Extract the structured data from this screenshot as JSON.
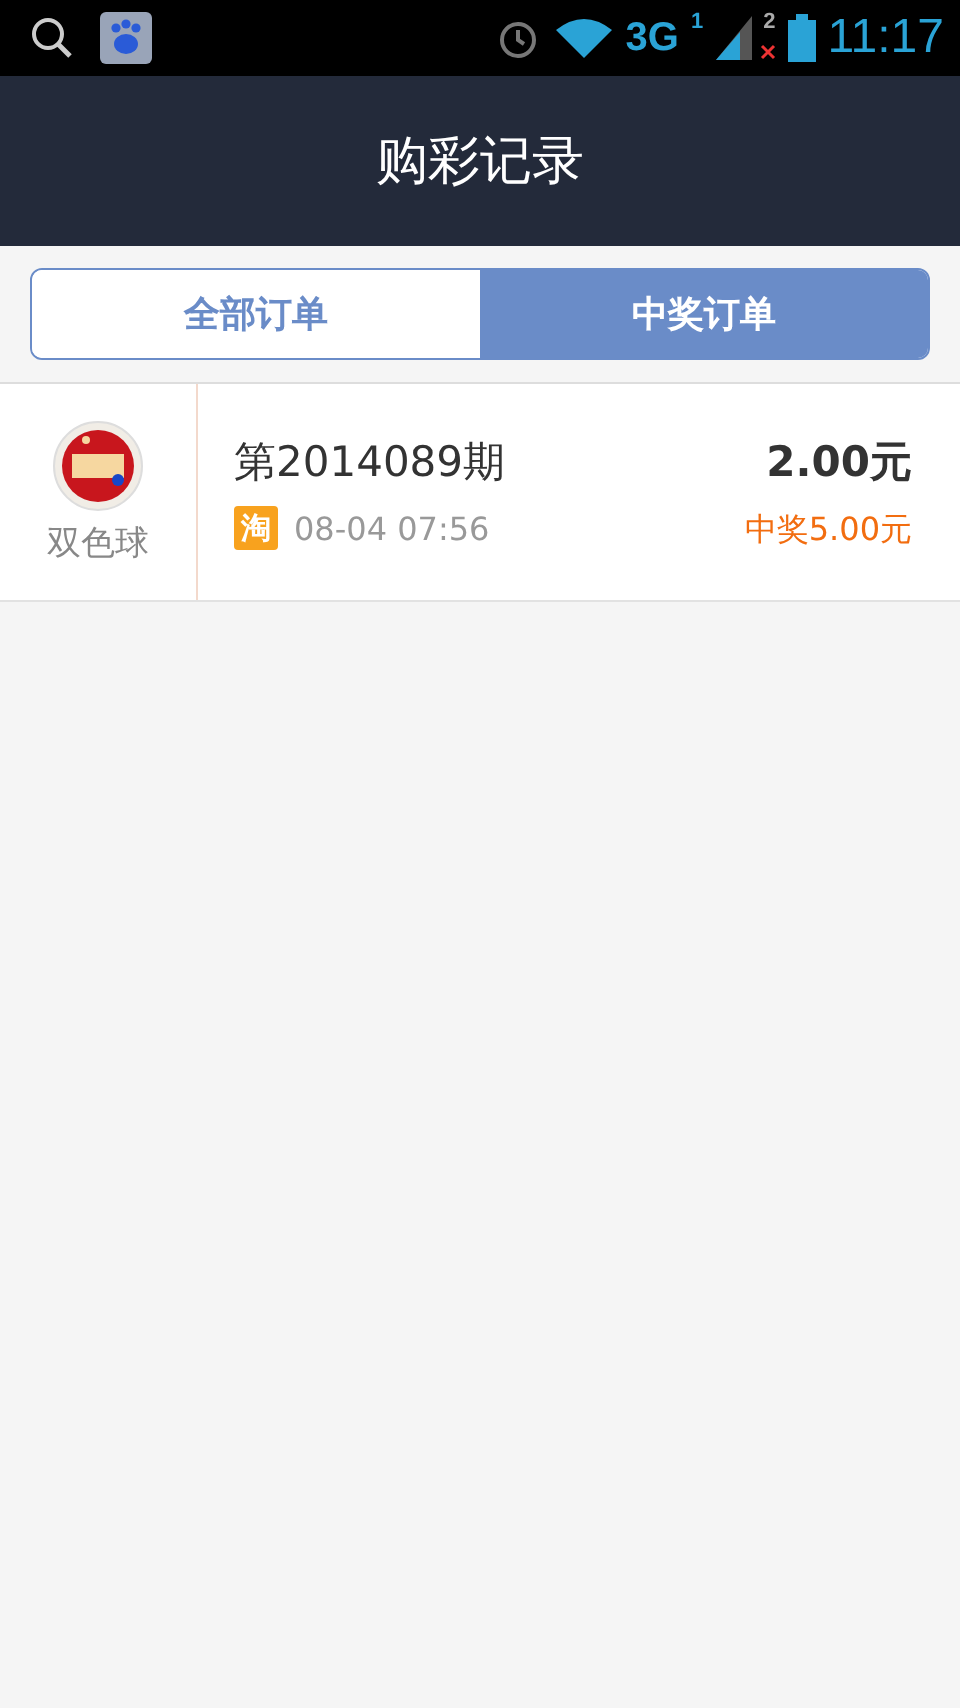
{
  "status_bar": {
    "network": "3G",
    "sim1": "1",
    "sim2": "2",
    "time": "11:17"
  },
  "header": {
    "title": "购彩记录"
  },
  "tabs": [
    {
      "label": "全部订单",
      "selected": false
    },
    {
      "label": "中奖订单",
      "selected": true
    }
  ],
  "orders": [
    {
      "game": "双色球",
      "issue": "第2014089期",
      "source_badge": "淘",
      "time": "08-04 07:56",
      "amount": "2.00元",
      "prize": "中奖5.00元"
    }
  ]
}
